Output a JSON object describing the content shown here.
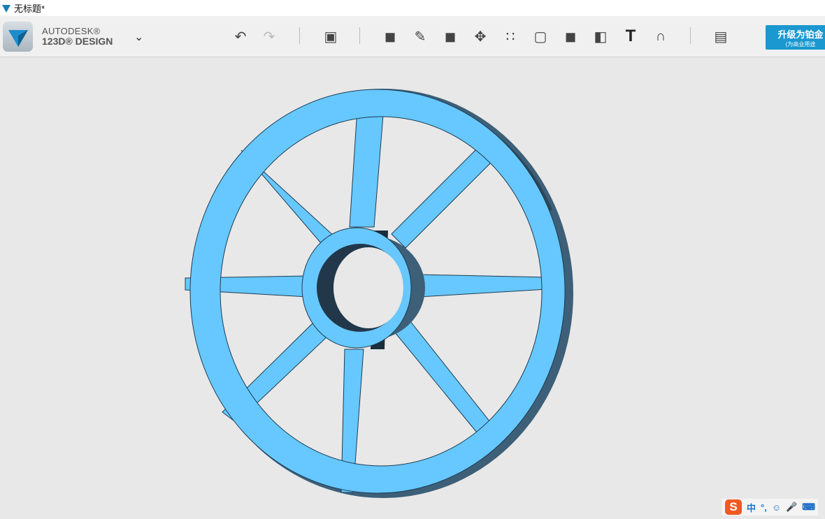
{
  "window": {
    "title": "无标题*"
  },
  "brand": {
    "line1": "AUTODESK®",
    "line2": "123D® DESIGN"
  },
  "toolbar": {
    "menu_icon": "chevron-down-icon",
    "tools": [
      "undo-icon",
      "redo-icon",
      "transform-icon",
      "primitives-icon",
      "sketch-icon",
      "construct-icon",
      "modify-icon",
      "pattern-icon",
      "grouping-icon",
      "combine-icon",
      "measure-icon",
      "text-icon",
      "snap-icon",
      "material-icon"
    ],
    "upgrade": {
      "label": "升级为铂金",
      "sub": "(为商业用途"
    }
  },
  "ime": {
    "logo": "S",
    "mode": "中",
    "punct": "°,",
    "icons": [
      "emoji-icon",
      "microphone-icon",
      "keyboard-icon"
    ]
  },
  "colors": {
    "model": "#66c8ff",
    "model_shadow": "#1f3444",
    "accent": "#1a98cf"
  }
}
